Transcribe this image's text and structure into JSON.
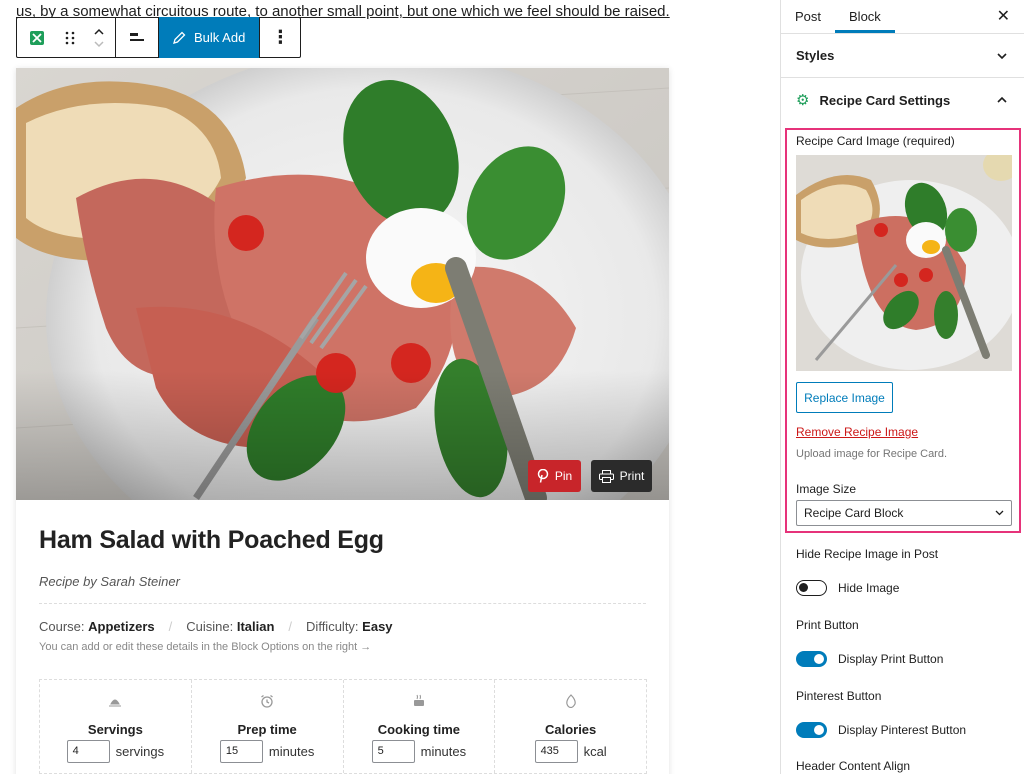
{
  "editor": {
    "paragraph_text": "us, by a somewhat circuitous route, to another small point, but one which we feel should be raised.",
    "toolbar": {
      "bulk_add_label": "Bulk Add"
    }
  },
  "recipe": {
    "pin_label": "Pin",
    "print_label": "Print",
    "title": "Ham Salad with Poached Egg",
    "author": "Recipe by Sarah Steiner",
    "details": {
      "course_label": "Course:",
      "course_value": "Appetizers",
      "cuisine_label": "Cuisine:",
      "cuisine_value": "Italian",
      "difficulty_label": "Difficulty:",
      "difficulty_value": "Easy",
      "hint": "You can add or edit these details in the Block Options on the right →"
    },
    "stats": [
      {
        "icon": "servings-icon",
        "label": "Servings",
        "value": "4",
        "unit": "servings"
      },
      {
        "icon": "alarm-clock-icon",
        "label": "Prep time",
        "value": "15",
        "unit": "minutes"
      },
      {
        "icon": "cooking-pot-icon",
        "label": "Cooking time",
        "value": "5",
        "unit": "minutes"
      },
      {
        "icon": "flame-icon",
        "label": "Calories",
        "value": "435",
        "unit": "kcal"
      }
    ]
  },
  "sidebar": {
    "tabs": [
      {
        "label": "Post"
      },
      {
        "label": "Block"
      }
    ],
    "close_glyph": "✕",
    "styles_panel": "Styles",
    "recipe_settings_panel": "Recipe Card Settings",
    "image_label": "Recipe Card Image (required)",
    "replace_image": "Replace Image",
    "remove_image": "Remove Recipe Image",
    "upload_help": "Upload image for Recipe Card.",
    "image_size_label": "Image Size",
    "image_size_value": "Recipe Card Block",
    "hide_image_section": "Hide Recipe Image in Post",
    "hide_image_toggle": "Hide Image",
    "print_section": "Print Button",
    "print_toggle": "Display Print Button",
    "pinterest_section": "Pinterest Button",
    "pinterest_toggle": "Display Pinterest Button",
    "header_align_section": "Header Content Align"
  },
  "colors": {
    "accent": "#007cba",
    "pin": "#c8252a",
    "highlight": "#e6337a",
    "gear": "#1e9e5a",
    "remove_link": "#cc1818"
  }
}
